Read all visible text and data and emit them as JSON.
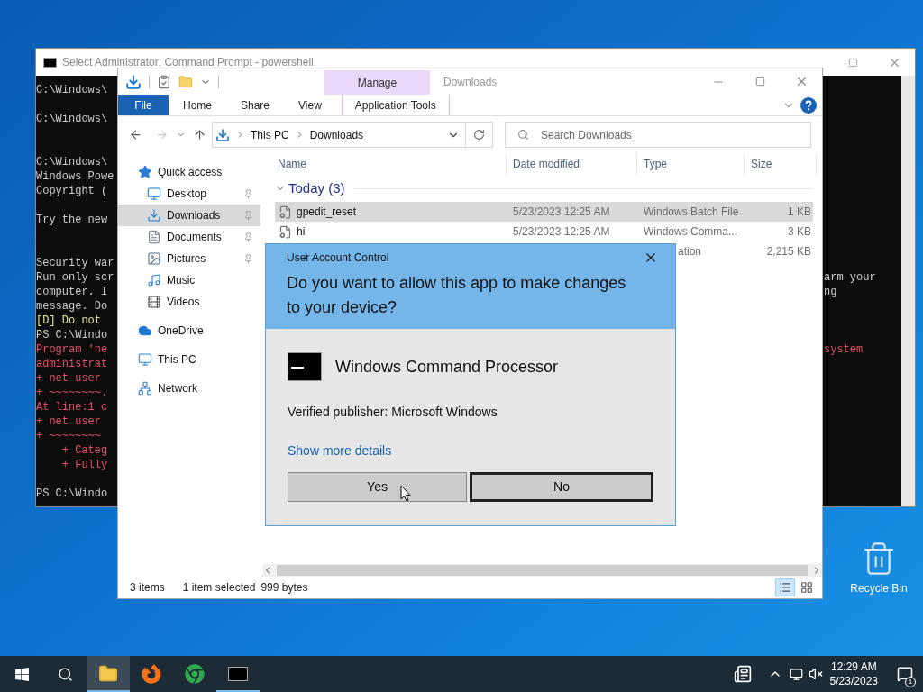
{
  "desktop": {
    "icons": [
      {
        "label": "Recycle Bin"
      }
    ]
  },
  "cmd_window": {
    "title": "Select Administrator:  Command Prompt - powershell",
    "blocks": [
      {
        "kind": "start",
        "lines": [
          {
            "kind": "normal",
            "left": "C:\\Windows\\"
          }
        ]
      },
      {
        "kind": "gap",
        "lines": [
          {
            "kind": "normal",
            "left": "C:\\Windows\\"
          }
        ]
      },
      {
        "kind": "widegap",
        "lines": [
          {
            "kind": "normal",
            "left": "C:\\Windows\\"
          },
          {
            "kind": "normal",
            "left": "Windows Powe"
          },
          {
            "kind": "normal",
            "left": "Copyright ("
          }
        ]
      },
      {
        "kind": "gap",
        "lines": [
          {
            "kind": "normal",
            "left": "Try the new"
          }
        ]
      },
      {
        "kind": "widegap",
        "lines": [
          {
            "kind": "normal",
            "left": "Security war"
          },
          {
            "kind": "normal",
            "left": "Run only scr",
            "right": "arm your"
          },
          {
            "kind": "normal",
            "left": "computer. I",
            "right": "ng"
          },
          {
            "kind": "normal",
            "left": "message. Do"
          },
          {
            "kind": "option",
            "left": "[D] Do not"
          },
          {
            "kind": "normal",
            "left": "PS C:\\Windo"
          },
          {
            "kind": "error",
            "left": "Program 'ne",
            "right": "system"
          },
          {
            "kind": "error",
            "left": "administrat"
          },
          {
            "kind": "error",
            "left": "+ net user"
          },
          {
            "kind": "error",
            "left": "+ ~~~~~~~~."
          },
          {
            "kind": "error",
            "left": "At line:1 c"
          },
          {
            "kind": "error",
            "left": "+ net user"
          },
          {
            "kind": "error",
            "left": "+ ~~~~~~~~"
          },
          {
            "kind": "error",
            "left": "    + Categ"
          },
          {
            "kind": "error",
            "left": "    + Fully"
          }
        ]
      },
      {
        "kind": "gap",
        "lines": [
          {
            "kind": "normal",
            "left": "PS C:\\Windo"
          }
        ]
      }
    ]
  },
  "explorer": {
    "contextual_tab": "Manage",
    "title": "Downloads",
    "ribbon_tabs": [
      {
        "kind": "file",
        "label": "File"
      },
      {
        "kind": "plain",
        "label": "Home"
      },
      {
        "kind": "plain",
        "label": "Share"
      },
      {
        "kind": "plain",
        "label": "View"
      },
      {
        "kind": "contextual",
        "label": "Application Tools"
      }
    ],
    "address": {
      "path": [
        "This PC",
        "Downloads"
      ]
    },
    "search": {
      "placeholder": "Search Downloads"
    },
    "columns": [
      "Name",
      "Date modified",
      "Type",
      "Size"
    ],
    "sidebar": {
      "items": [
        {
          "kind": "quick_access",
          "label": "Quick access",
          "selected": false,
          "pinned": false,
          "children": [
            {
              "kind": "desktop",
              "label": "Desktop",
              "selected": false,
              "pinned": true
            },
            {
              "kind": "downloads",
              "label": "Downloads",
              "selected": true,
              "pinned": true
            },
            {
              "kind": "documents",
              "label": "Documents",
              "selected": false,
              "pinned": true
            },
            {
              "kind": "pictures",
              "label": "Pictures",
              "selected": false,
              "pinned": true
            },
            {
              "kind": "music",
              "label": "Music",
              "selected": false,
              "pinned": false
            },
            {
              "kind": "videos",
              "label": "Videos",
              "selected": false,
              "pinned": false
            }
          ]
        },
        {
          "kind": "onedrive",
          "label": "OneDrive",
          "selected": false,
          "pinned": false
        },
        {
          "kind": "this_pc",
          "label": "This PC",
          "selected": false,
          "pinned": false
        },
        {
          "kind": "network",
          "label": "Network",
          "selected": false,
          "pinned": false
        }
      ]
    },
    "groups": [
      {
        "label": "Today (3)",
        "expanded": true,
        "rows": [
          {
            "kind": "full",
            "selected": true,
            "name": "gpedit_reset",
            "date": "5/23/2023 12:25 AM",
            "type": "Windows Batch File",
            "size": "1 KB"
          },
          {
            "kind": "full",
            "selected": false,
            "name": "hi",
            "date": "5/23/2023 12:25 AM",
            "type": "Windows Comma...",
            "size": "3 KB"
          },
          {
            "kind": "partial",
            "selected": false,
            "type": "ation",
            "size": "2,215 KB"
          }
        ]
      }
    ],
    "status_bar": {
      "item_count": "3 items",
      "selection": "1 item selected",
      "size": "999 bytes"
    },
    "view_buttons": [
      {
        "kind": "details",
        "selected": true
      },
      {
        "kind": "large_icons",
        "selected": false
      }
    ]
  },
  "uac": {
    "title": "User Account Control",
    "question": "Do you want to allow this app to make changes to your device?",
    "app_name": "Windows Command Processor",
    "publisher": "Verified publisher: Microsoft Windows",
    "details_link": "Show more details",
    "buttons": [
      {
        "label": "Yes",
        "selected": false
      },
      {
        "label": "No",
        "selected": true
      }
    ]
  },
  "taskbar": {
    "apps": [
      {
        "kind": "explorer",
        "active": true,
        "running": true
      },
      {
        "kind": "firefox",
        "active": false,
        "running": false
      },
      {
        "kind": "chrome",
        "active": false,
        "running": false
      },
      {
        "kind": "cmd",
        "active": false,
        "running": true
      }
    ],
    "clock": {
      "time": "12:29 AM",
      "date": "5/23/2023"
    },
    "notifications": {
      "count": "1"
    }
  }
}
